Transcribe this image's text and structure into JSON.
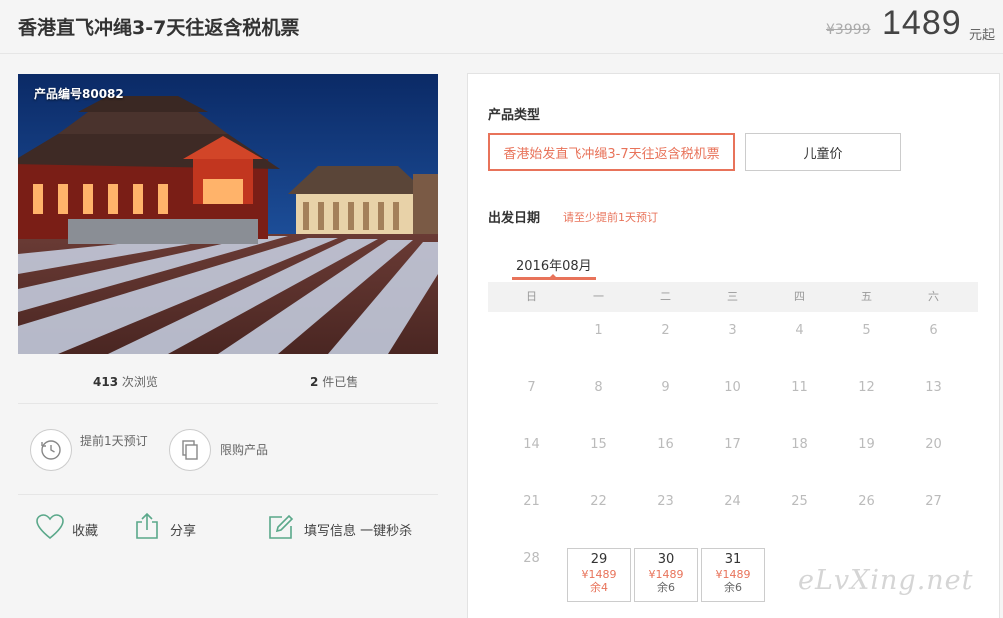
{
  "header": {
    "title": "香港直飞冲绳3-7天往返含税机票",
    "original_price": "¥3999",
    "price": "1489",
    "price_unit": "元起"
  },
  "photo": {
    "product_code": "产品编号80082"
  },
  "stats": {
    "views_count": "413",
    "views_label": "次浏览",
    "sold_count": "2",
    "sold_label": "件已售"
  },
  "features": {
    "advance_booking": "提前1天预订",
    "limited": "限购产品"
  },
  "actions": {
    "favorite": "收藏",
    "share": "分享",
    "fill_info": "填写信息 一键秒杀"
  },
  "booking": {
    "product_type_label": "产品类型",
    "options": [
      {
        "label": "香港始发直飞冲绳3-7天往返含税机票",
        "selected": true
      },
      {
        "label": "儿童价",
        "selected": false
      }
    ],
    "departure_label": "出发日期",
    "advance_note": "请至少提前1天预订"
  },
  "calendar": {
    "month": "2016年08月",
    "weekdays": [
      "日",
      "一",
      "二",
      "三",
      "四",
      "五",
      "六"
    ],
    "rows": [
      [
        "",
        "1",
        "2",
        "3",
        "4",
        "5",
        "6"
      ],
      [
        "7",
        "8",
        "9",
        "10",
        "11",
        "12",
        "13"
      ],
      [
        "14",
        "15",
        "16",
        "17",
        "18",
        "19",
        "20"
      ],
      [
        "21",
        "22",
        "23",
        "24",
        "25",
        "26",
        "27"
      ],
      [
        "28"
      ]
    ],
    "available": [
      {
        "day": "29",
        "price": "¥1489",
        "remaining": "余4",
        "remaining_highlight": true
      },
      {
        "day": "30",
        "price": "¥1489",
        "remaining": "余6",
        "remaining_highlight": false
      },
      {
        "day": "31",
        "price": "¥1489",
        "remaining": "余6",
        "remaining_highlight": false
      }
    ]
  },
  "watermark": "eLvXing.net",
  "colors": {
    "accent": "#e8735a",
    "icon_green": "#5aa88a"
  }
}
